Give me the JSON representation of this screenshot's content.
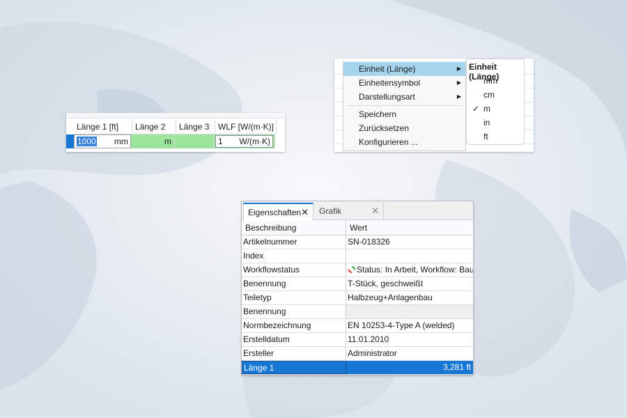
{
  "grid": {
    "columns": [
      "Länge 1 [ft]",
      "Länge 2",
      "Länge 3",
      "WLF [W/(m·K)]"
    ],
    "row": {
      "laenge1_value": "1000",
      "laenge1_unit": "mm",
      "laenge2_unit": "m",
      "wlf_value": "1",
      "wlf_unit": "W/(m·K)"
    }
  },
  "context_menu": {
    "items": [
      {
        "label": "Einheit (Länge)",
        "submenu": true
      },
      {
        "label": "Einheitensymbol",
        "submenu": true
      },
      {
        "label": "Darstellungsart",
        "submenu": true
      },
      {
        "label": "Speichern",
        "submenu": false
      },
      {
        "label": "Zurücksetzen",
        "submenu": false
      },
      {
        "label": "Konfigurieren ...",
        "submenu": false
      }
    ],
    "submenu": {
      "title": "Einheit (Länge)",
      "options": [
        "mm",
        "cm",
        "m",
        "in",
        "ft"
      ],
      "checked": "m",
      "check_glyph": "✓"
    }
  },
  "properties": {
    "tabs": [
      {
        "label": "Eigenschaften",
        "active": true
      },
      {
        "label": "Grafik",
        "active": false
      }
    ],
    "headers": {
      "description": "Beschreibung",
      "value": "Wert"
    },
    "rows": [
      {
        "key": "Artikelnummer",
        "value": "SN-018326"
      },
      {
        "key": "Index",
        "value": ""
      },
      {
        "key": "Workflowstatus",
        "value": "Status: In Arbeit, Workflow: Bau"
      },
      {
        "key": "Benennung",
        "value": "T-Stück, geschweißt"
      },
      {
        "key": "Teiletyp",
        "value": "Halbzeug+Anlagenbau"
      },
      {
        "key": "Benennung",
        "value": ""
      },
      {
        "key": "Normbezeichnung",
        "value": "EN 10253-4-Type A (welded)"
      },
      {
        "key": "Erstelldatum",
        "value": "11.01.2010"
      },
      {
        "key": "Ersteller",
        "value": "Administrator"
      },
      {
        "key": "Länge 1",
        "value": "3,281 ft"
      }
    ]
  },
  "icons": {
    "tab_close": "close-icon",
    "submenu_arrow": "chevron-right-icon",
    "workflow": "refresh-status-icon"
  },
  "colors": {
    "selection": "#1677d4",
    "highlight": "#a6d4ed",
    "green_cell": "#9be49b"
  }
}
